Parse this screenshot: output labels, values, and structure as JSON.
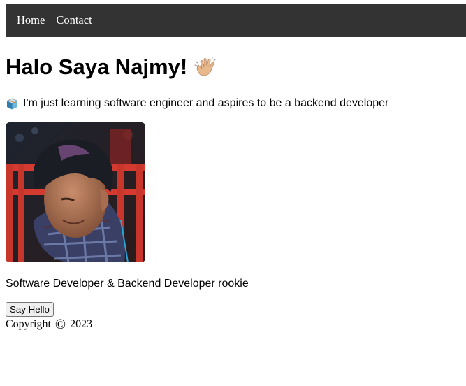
{
  "nav": {
    "items": [
      {
        "label": "Home"
      },
      {
        "label": "Contact"
      }
    ],
    "background": "#333333",
    "text_color": "#ffffff"
  },
  "hero": {
    "heading": "Halo Saya Najmy!",
    "heading_icon": "waving-hand-icon",
    "intro_icon": "package-box-icon",
    "intro": "I'm just learning software engineer and aspires to be a backend developer"
  },
  "profile": {
    "photo_icon": "profile-photo",
    "role": "Software Developer & Backend Developer rookie"
  },
  "actions": {
    "say_hello": "Say Hello"
  },
  "footer": {
    "label": "Copyright",
    "symbol": "©",
    "year": "2023"
  }
}
